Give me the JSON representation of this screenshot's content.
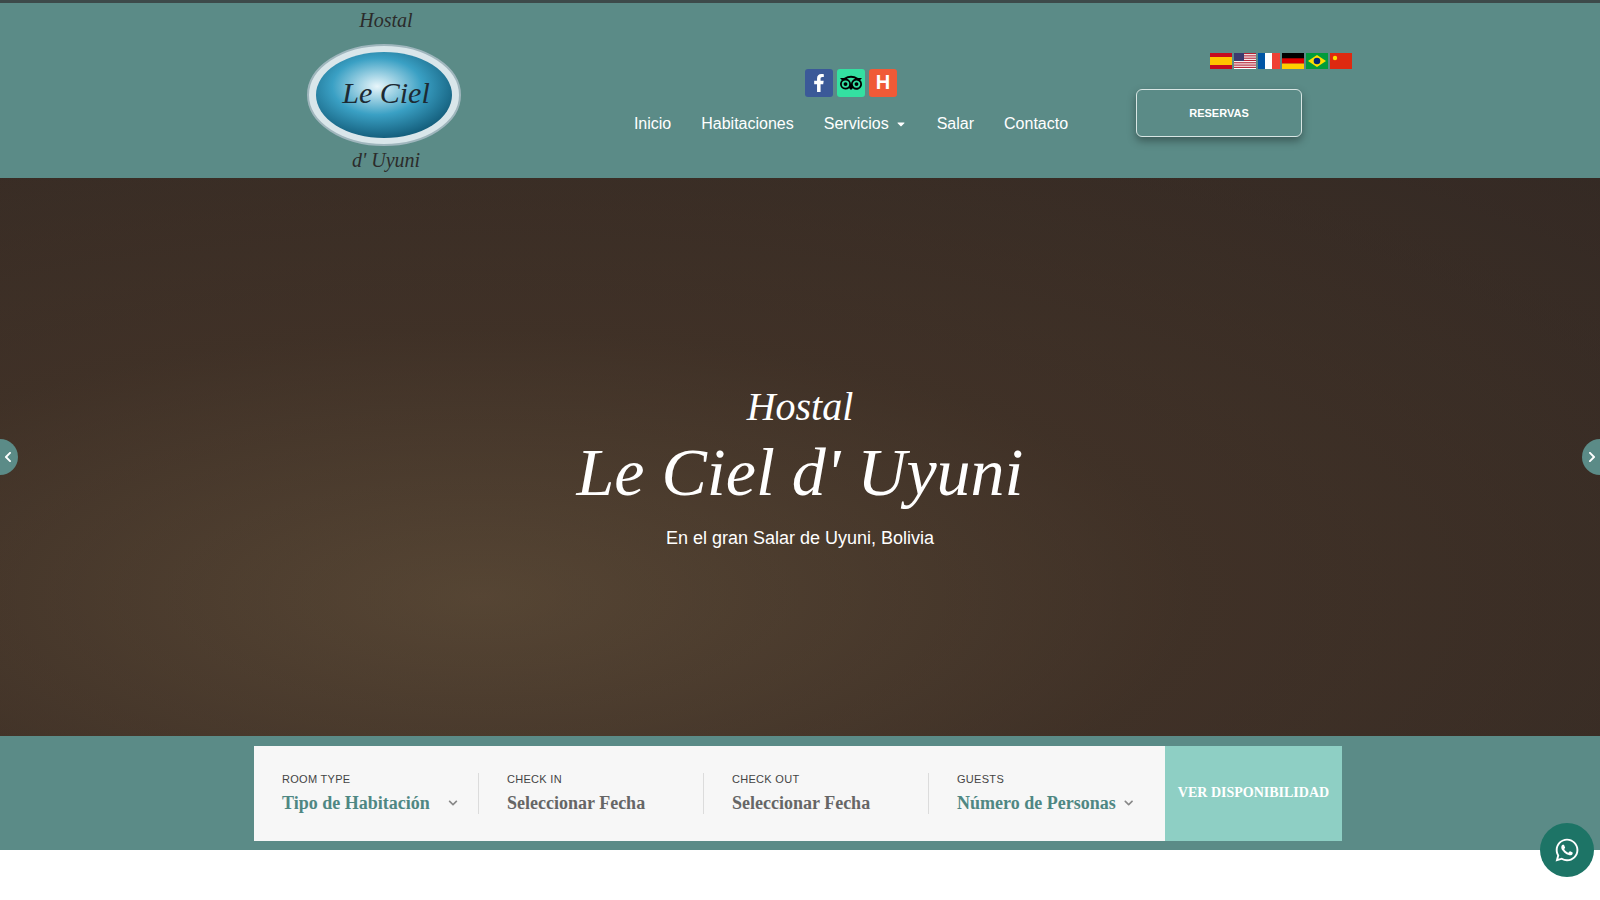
{
  "logo": {
    "top": "Hostal",
    "main": "Le Ciel",
    "bottom": "d' Uyuni"
  },
  "social": [
    {
      "kind": "facebook"
    },
    {
      "kind": "tripadvisor"
    },
    {
      "kind": "letter",
      "text": "H"
    }
  ],
  "nav": [
    {
      "label": "Inicio",
      "has_menu": false
    },
    {
      "label": "Habitaciones",
      "has_menu": false
    },
    {
      "label": "Servicios",
      "has_menu": true
    },
    {
      "label": "Salar",
      "has_menu": false
    },
    {
      "label": "Contacto",
      "has_menu": false
    }
  ],
  "flags": [
    {
      "kind": "es"
    },
    {
      "kind": "us"
    },
    {
      "kind": "fr"
    },
    {
      "kind": "de"
    },
    {
      "kind": "br"
    },
    {
      "kind": "cn"
    }
  ],
  "reserve_button": "RESERVAS",
  "hero": {
    "kicker": "Hostal",
    "title": "Le Ciel d' Uyuni",
    "subtitle": "En el gran Salar de Uyuni, Bolivia"
  },
  "booking": {
    "fields": [
      {
        "label": "ROOM TYPE",
        "value": "Tipo de Habitación",
        "kind": "select"
      },
      {
        "label": "CHECK IN",
        "value": "Seleccionar Fecha",
        "kind": "date"
      },
      {
        "label": "CHECK OUT",
        "value": "Seleccionar Fecha",
        "kind": "date"
      },
      {
        "label": "GUESTS",
        "value": "Número de Personas",
        "kind": "select"
      }
    ],
    "button": "VER DISPONIBILIDAD"
  }
}
